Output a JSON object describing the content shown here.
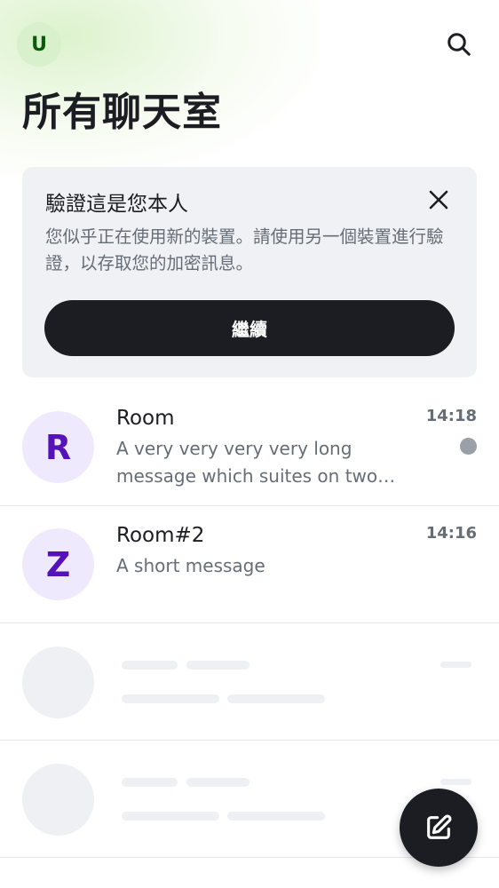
{
  "header": {
    "user_initial": "U",
    "title": "所有聊天室",
    "search_icon": "search-icon"
  },
  "verify_banner": {
    "title": "驗證這是您本人",
    "body": "您似乎正在使用新的裝置。請使用另一個裝置進行驗證，以存取您的加密訊息。",
    "button_label": "繼續",
    "close_icon": "close-icon"
  },
  "rooms": [
    {
      "initial": "R",
      "name": "Room",
      "time": "14:18",
      "message": "A very very very very long message which suites on two lines",
      "unread": true
    },
    {
      "initial": "Z",
      "name": "Room#2",
      "time": "14:16",
      "message": "A short message",
      "unread": false
    }
  ],
  "colors": {
    "accent_dark": "#1b1d22",
    "user_avatar_bg": "#d9f0cc",
    "room_avatar_bg": "#efe9fd",
    "room_avatar_fg": "#5512b8",
    "secondary_text": "#656d77"
  },
  "fab": {
    "icon": "compose-icon"
  }
}
